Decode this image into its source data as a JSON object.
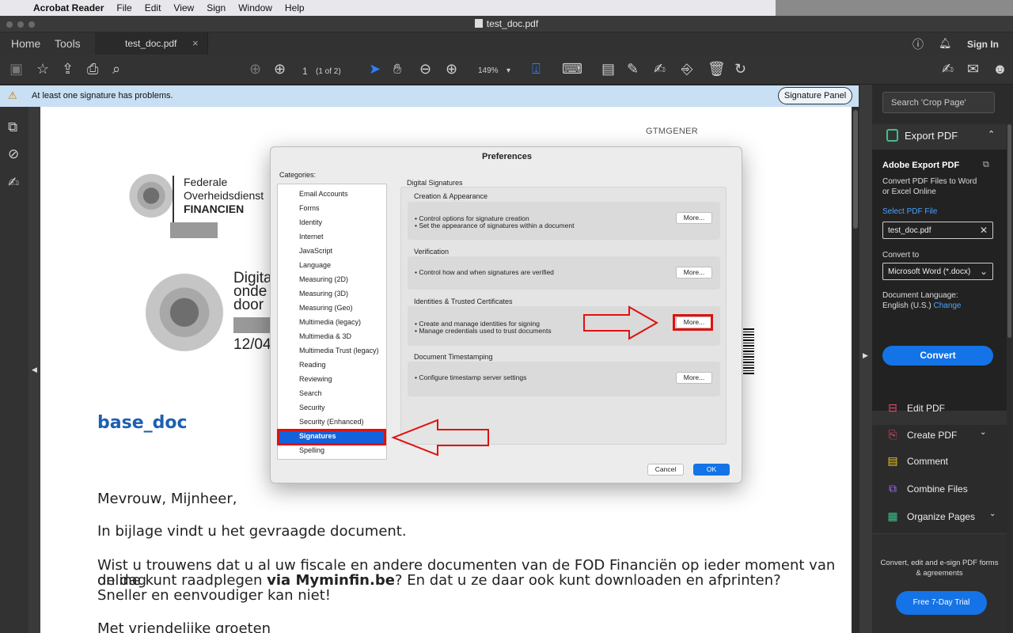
{
  "menubar": {
    "apple_icon": "apple-logo",
    "app_name": "Acrobat Reader",
    "items": [
      "File",
      "Edit",
      "View",
      "Sign",
      "Window",
      "Help"
    ]
  },
  "window": {
    "title": "test_doc.pdf"
  },
  "tabs": {
    "home": "Home",
    "tools": "Tools",
    "doc_tab": "test_doc.pdf",
    "close": "×",
    "sign_in": "Sign In"
  },
  "toolbar": {
    "page_num": "1",
    "page_count": "(1 of 2)",
    "zoom": "149%",
    "zoom_chevron": "▾"
  },
  "notification": {
    "message": "At least one signature has problems.",
    "button": "Signature Panel"
  },
  "document": {
    "header_code": "GTMGENER",
    "org_line1": "Federale",
    "org_line2": "Overheidsdienst",
    "org_line3": "FINANCIEN",
    "digi_line1": "Digita",
    "digi_line2": "onde",
    "digi_line3": "door",
    "date_partial": "12/04",
    "heading": "base_doc",
    "greeting": "Mevrouw, Mijnheer,",
    "para1": "In bijlage vindt u het gevraagde document.",
    "para2_a": "Wist u trouwens dat u al uw fiscale en andere documenten van de FOD Financiën op ieder moment van de dag",
    "para2_b1": "online kunt raadplegen ",
    "para2_b_bold": "via Myminfin.be",
    "para2_b2": "? En dat u ze daar ook kunt downloaden en afprinten?",
    "para2_c": "Sneller en eenvoudiger kan niet!",
    "closing": "Met vriendelijke groeten"
  },
  "right_panel": {
    "search_placeholder": "Search 'Crop Page'",
    "export_title": "Export PDF",
    "export_chevron": "⌃",
    "card_title": "Adobe Export PDF",
    "card_desc_1": "Convert PDF Files to Word",
    "card_desc_2": "or Excel Online",
    "select_label": "Select PDF File",
    "selected_file": "test_doc.pdf",
    "clear": "✕",
    "convert_to_label": "Convert to",
    "convert_to_value": "Microsoft Word (*.docx)",
    "convert_to_chevron": "⌄",
    "doc_lang_label": "Document Language:",
    "doc_lang_value": "English (U.S.)",
    "doc_lang_change": "Change",
    "convert_button": "Convert",
    "tools": [
      {
        "label": "Edit PDF",
        "icon": "edit-pdf-icon",
        "color": "#e24a6a",
        "chevron": ""
      },
      {
        "label": "Create PDF",
        "icon": "create-pdf-icon",
        "color": "#e24a6a",
        "chevron": "⌄"
      },
      {
        "label": "Comment",
        "icon": "comment-icon",
        "color": "#f2c31c",
        "chevron": ""
      },
      {
        "label": "Combine Files",
        "icon": "combine-files-icon",
        "color": "#9b6cf3",
        "chevron": ""
      },
      {
        "label": "Organize Pages",
        "icon": "organize-pages-icon",
        "color": "#3bc18a",
        "chevron": "⌄"
      }
    ],
    "promo_text": "Convert, edit and e-sign PDF forms & agreements",
    "trial_button": "Free 7-Day Trial"
  },
  "dialog": {
    "title": "Preferences",
    "categories_label": "Categories:",
    "categories": [
      "Email Accounts",
      "Forms",
      "Identity",
      "Internet",
      "JavaScript",
      "Language",
      "Measuring (2D)",
      "Measuring (3D)",
      "Measuring (Geo)",
      "Multimedia (legacy)",
      "Multimedia & 3D",
      "Multimedia Trust (legacy)",
      "Reading",
      "Reviewing",
      "Search",
      "Security",
      "Security (Enhanced)",
      "Signatures",
      "Spelling"
    ],
    "selected_category": "Signatures",
    "panel_title": "Digital Signatures",
    "sections": [
      {
        "title": "Creation & Appearance",
        "bullets": [
          "• Control options for signature creation",
          "• Set the appearance of signatures within a document"
        ],
        "button": "More..."
      },
      {
        "title": "Verification",
        "bullets": [
          "• Control how and when signatures are verified"
        ],
        "button": "More..."
      },
      {
        "title": "Identities & Trusted Certificates",
        "bullets": [
          "• Create and manage identities for signing",
          "• Manage credentials used to trust documents"
        ],
        "button": "More..."
      },
      {
        "title": "Document Timestamping",
        "bullets": [
          "• Configure timestamp server settings"
        ],
        "button": "More..."
      }
    ],
    "cancel": "Cancel",
    "ok": "OK"
  },
  "colors": {
    "accent_blue": "#1473e6",
    "selection_blue": "#1362dc",
    "annotation_red": "#e01010",
    "notification_bg": "#c8dff4",
    "heading_blue": "#1d5fb3"
  }
}
